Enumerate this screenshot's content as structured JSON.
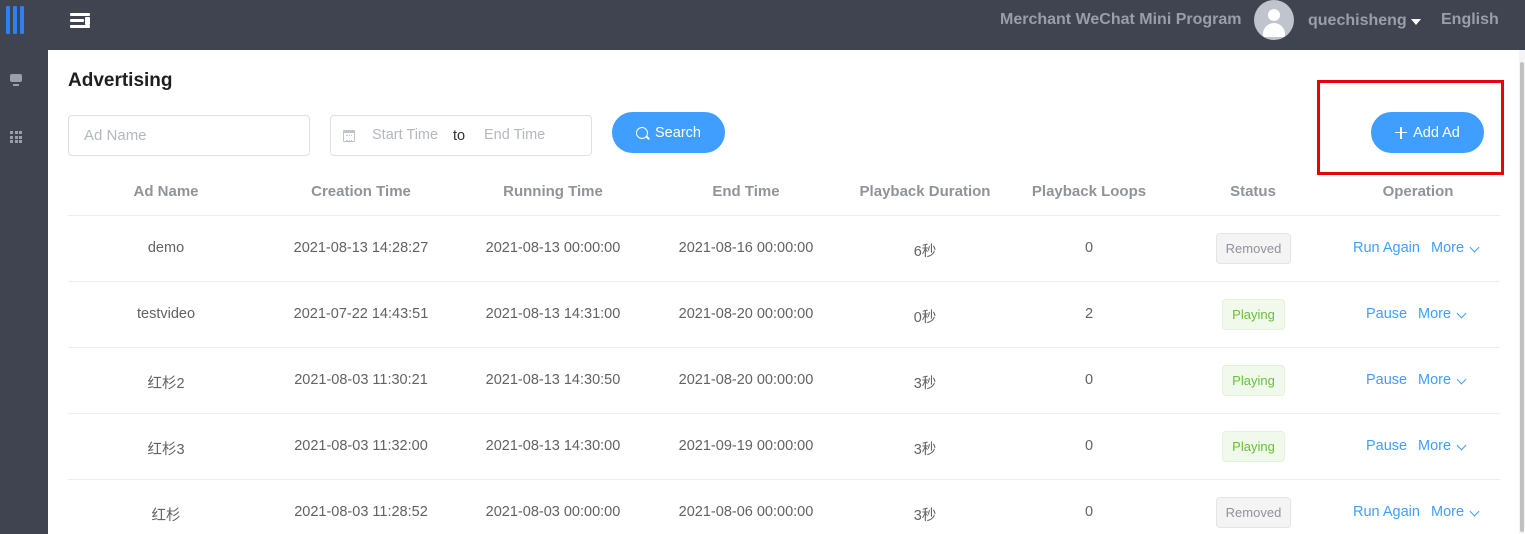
{
  "topbar": {
    "program_title": "Merchant WeChat Mini Program",
    "username": "quechisheng",
    "language": "English"
  },
  "page": {
    "title": "Advertising"
  },
  "filters": {
    "ad_name_placeholder": "Ad Name",
    "start_time_placeholder": "Start Time",
    "range_separator": "to",
    "end_time_placeholder": "End Time",
    "search_label": "Search",
    "add_label": "Add Ad"
  },
  "table": {
    "columns": [
      "Ad Name",
      "Creation Time",
      "Running Time",
      "End Time",
      "Playback Duration",
      "Playback Loops",
      "Status",
      "Operation"
    ],
    "rows": [
      {
        "name": "demo",
        "created": "2021-08-13 14:28:27",
        "running": "2021-08-13 00:00:00",
        "end": "2021-08-16 00:00:00",
        "duration": "6秒",
        "loops": "0",
        "status": "Removed",
        "primary_op": "Run Again",
        "more": "More"
      },
      {
        "name": "testvideo",
        "created": "2021-07-22 14:43:51",
        "running": "2021-08-13 14:31:00",
        "end": "2021-08-20 00:00:00",
        "duration": "0秒",
        "loops": "2",
        "status": "Playing",
        "primary_op": "Pause",
        "more": "More"
      },
      {
        "name": "红杉2",
        "created": "2021-08-03 11:30:21",
        "running": "2021-08-13 14:30:50",
        "end": "2021-08-20 00:00:00",
        "duration": "3秒",
        "loops": "0",
        "status": "Playing",
        "primary_op": "Pause",
        "more": "More"
      },
      {
        "name": "红杉3",
        "created": "2021-08-03 11:32:00",
        "running": "2021-08-13 14:30:00",
        "end": "2021-09-19 00:00:00",
        "duration": "3秒",
        "loops": "0",
        "status": "Playing",
        "primary_op": "Pause",
        "more": "More"
      },
      {
        "name": "红杉",
        "created": "2021-08-03 11:28:52",
        "running": "2021-08-03 00:00:00",
        "end": "2021-08-06 00:00:00",
        "duration": "3秒",
        "loops": "0",
        "status": "Removed",
        "primary_op": "Run Again",
        "more": "More"
      }
    ]
  },
  "colors": {
    "accent": "#409eff",
    "nav_bg": "#3f4450",
    "playing": "#67c23a",
    "removed": "#909399",
    "highlight": "#e8000e"
  },
  "icons": {
    "logo": "logo-icon",
    "menu_toggle": "menu-fold-icon",
    "sidebar": [
      "monitor-icon",
      "grid-icon"
    ],
    "avatar": "user-avatar-icon",
    "user_menu": "caret-down-icon",
    "calendar": "calendar-icon",
    "search": "search-icon",
    "add": "plus-icon",
    "more": "chevron-down-icon"
  }
}
